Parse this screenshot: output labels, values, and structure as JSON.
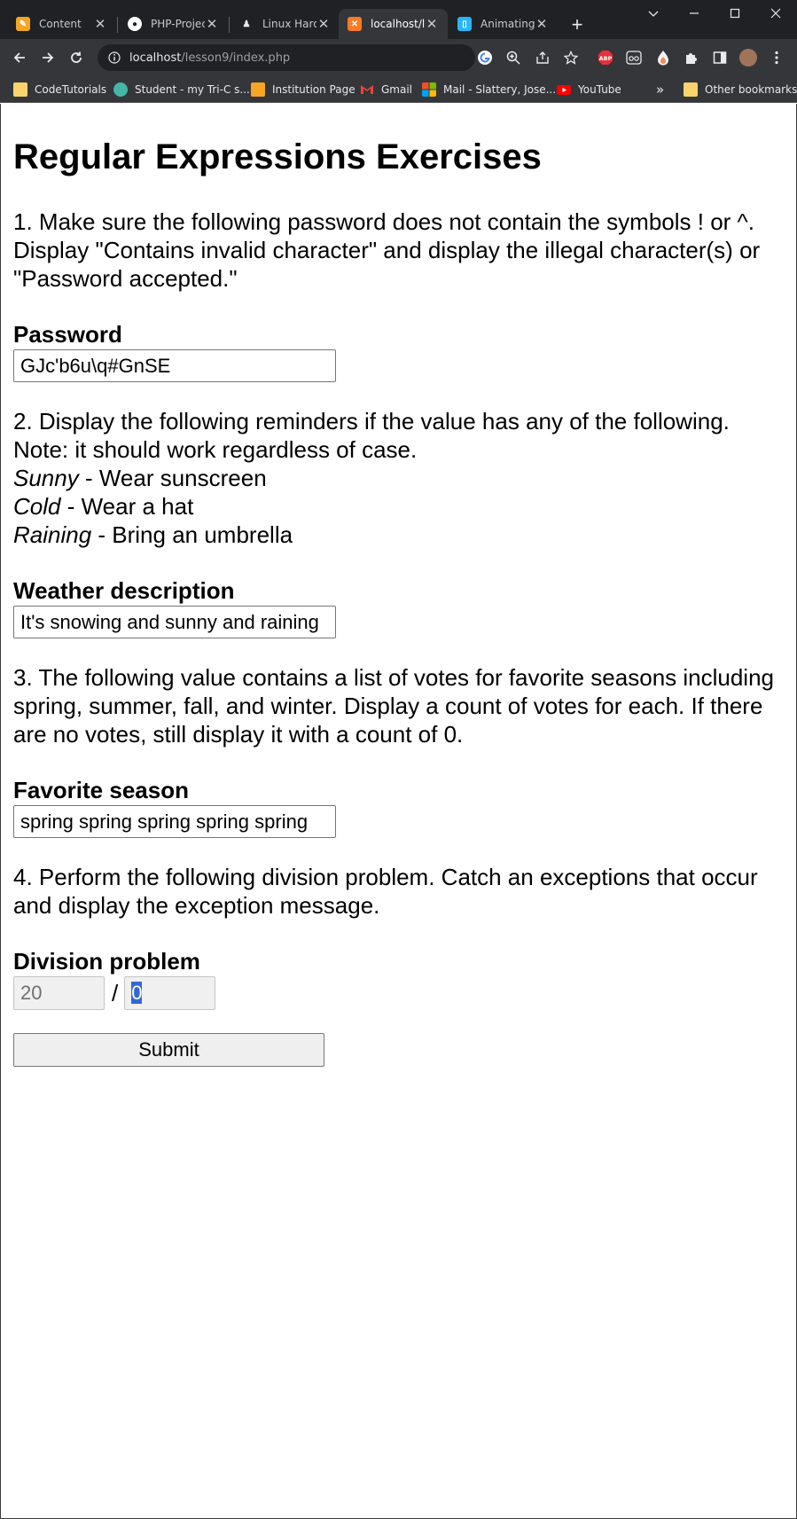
{
  "browser": {
    "tabs": [
      {
        "title": "Content",
        "active": false
      },
      {
        "title": "PHP-Projec",
        "active": false
      },
      {
        "title": "Linux Hard",
        "active": false
      },
      {
        "title": "localhost/le",
        "active": true
      },
      {
        "title": "Animating",
        "active": false
      }
    ],
    "url_host": "localhost",
    "url_path": "/lesson9/index.php",
    "bookmarks": [
      "CodeTutorials",
      "Student - my Tri-C s...",
      "Institution Page",
      "Gmail",
      "Mail - Slattery, Jose...",
      "YouTube"
    ],
    "other_bookmarks": "Other bookmarks",
    "overflow_symbol": "»",
    "abp_label": "ABP"
  },
  "page": {
    "title": "Regular Expressions Exercises",
    "q1": "1. Make sure the following password does not contain the symbols ! or ^. Display \"Contains invalid character\" and display the illegal character(s) or \"Password accepted.\"",
    "password_label": "Password",
    "password_value": "GJc'b6u\\q#GnSE",
    "q2_intro": "2. Display the following reminders if the value has any of the following. Note: it should work regardless of case.",
    "reminders": [
      {
        "keyword": "Sunny",
        "text": " - Wear sunscreen"
      },
      {
        "keyword": "Cold",
        "text": " - Wear a hat"
      },
      {
        "keyword": "Raining",
        "text": " - Bring an umbrella"
      }
    ],
    "weather_label": "Weather description",
    "weather_value": "It's snowing and sunny and raining",
    "q3": "3. The following value contains a list of votes for favorite seasons including spring, summer, fall, and winter. Display a count of votes for each. If there are no votes, still display it with a count of 0.",
    "season_label": "Favorite season",
    "season_value": "spring spring spring spring spring",
    "q4": "4. Perform the following division problem. Catch an exceptions that occur and display the exception message.",
    "division_label": "Division problem",
    "dividend": "20",
    "divide_symbol": "/",
    "divisor": "0",
    "submit_label": "Submit"
  }
}
